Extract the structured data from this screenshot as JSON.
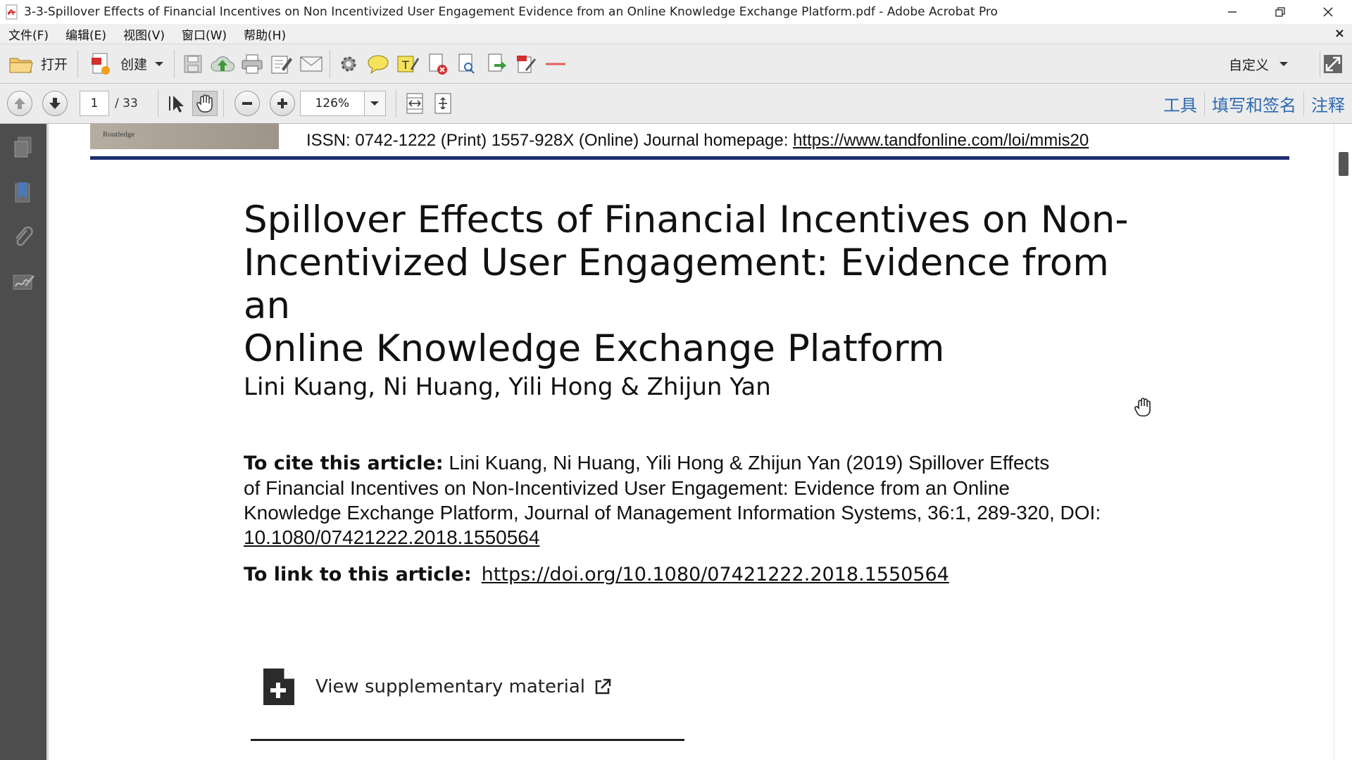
{
  "window": {
    "title": "3-3-Spillover Effects of Financial Incentives on Non Incentivized User Engagement Evidence from an Online Knowledge Exchange Platform.pdf - Adobe Acrobat Pro"
  },
  "menu": {
    "items": [
      "文件(F)",
      "编辑(E)",
      "视图(V)",
      "窗口(W)",
      "帮助(H)"
    ],
    "close_glyph": "×"
  },
  "toolbar": {
    "open_label": "打开",
    "create_label": "创建",
    "customize_label": "自定义"
  },
  "nav": {
    "current_page": "1",
    "total_pages": "/ 33",
    "zoom": "126%"
  },
  "panels": {
    "tools": "工具",
    "fill_sign": "填写和签名",
    "comment": "注释"
  },
  "document": {
    "header_logo_text": "Routledge",
    "issn_text": "ISSN: 0742-1222 (Print) 1557-928X (Online) Journal homepage: ",
    "homepage_url": "https://www.tandfonline.com/loi/mmis20",
    "title_line1": "Spillover Effects of Financial Incentives on Non-",
    "title_line2": "Incentivized User Engagement: Evidence from an",
    "title_line3": "Online Knowledge Exchange Platform",
    "authors": "Lini Kuang, Ni Huang, Yili Hong & Zhijun Yan",
    "cite_label": "To cite this article:",
    "cite_line1": " Lini Kuang, Ni Huang, Yili Hong & Zhijun Yan (2019) Spillover Effects",
    "cite_line2": "of Financial Incentives on Non-Incentivized User Engagement: Evidence from an Online",
    "cite_line3": "Knowledge Exchange Platform, Journal of Management Information Systems, 36:1, 289-320, DOI:",
    "cite_doi": "10.1080/07421222.2018.1550564",
    "link_label": "To link to this article:",
    "link_url": "https://doi.org/10.1080/07421222.2018.1550564",
    "supplementary_label": "View supplementary material"
  },
  "icons": {
    "app": "acrobat-icon",
    "cursor": "hand-cursor-icon"
  },
  "colors": {
    "accent_link": "#2e6ab0",
    "rule": "#1c2d6e",
    "nav_panel": "#4d4d4d"
  }
}
